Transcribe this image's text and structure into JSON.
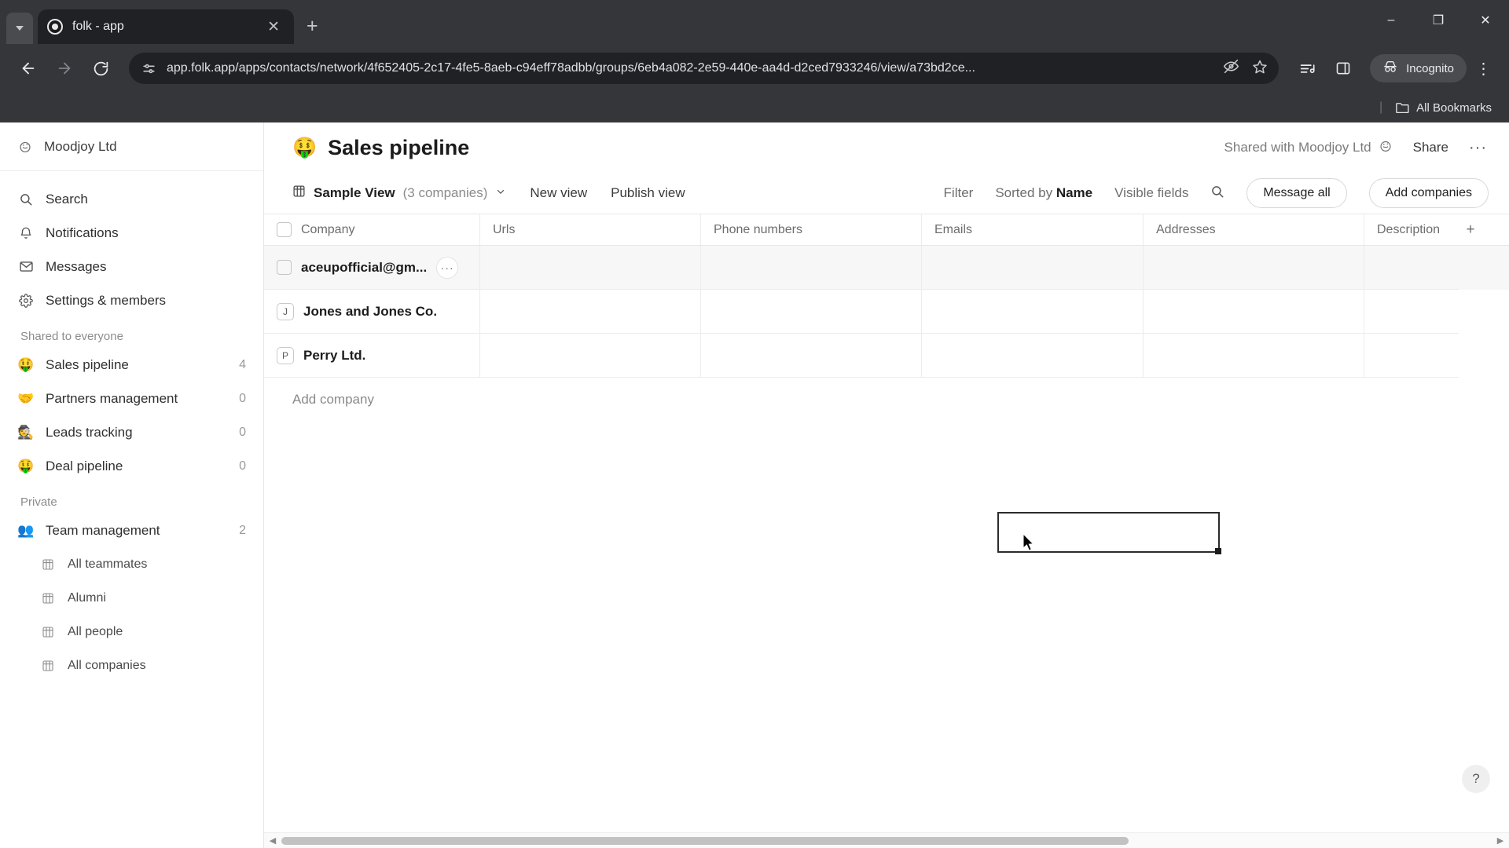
{
  "browser": {
    "tab": {
      "title": "folk - app",
      "favicon_icon": "folk-logo-icon",
      "close_icon": "close-icon"
    },
    "tab_list_icon": "chevron-down-icon",
    "new_tab_label": "+",
    "window_controls": {
      "minimize": "–",
      "maximize": "❐",
      "close": "✕"
    },
    "nav": {
      "back_icon": "arrow-left-icon",
      "forward_icon": "arrow-right-icon",
      "reload_icon": "reload-icon"
    },
    "omnibox": {
      "site_info_icon": "page-settings-icon",
      "url": "app.folk.app/apps/contacts/network/4f652405-2c17-4fe5-8aeb-c94eff78adbb/groups/6eb4a082-2e59-440e-aa4d-d2ced7933246/view/a73bd2ce...",
      "tracking_protection_icon": "eye-crossed-icon",
      "bookmark_icon": "star-icon"
    },
    "toolbar_right": {
      "reading_list_icon": "reading-list-icon",
      "side_panel_icon": "side-panel-icon",
      "incognito_label": "Incognito",
      "incognito_icon": "incognito-icon",
      "menu_icon": "kebab-menu-icon"
    },
    "bookmarks_bar": {
      "separator": "|",
      "all_bookmarks_label": "All Bookmarks",
      "folder_icon": "folder-icon"
    }
  },
  "sidebar": {
    "workspace": {
      "name": "Moodjoy Ltd",
      "logo_icon": "moodjoy-logo-icon"
    },
    "nav_items": [
      {
        "label": "Search",
        "icon": "search-icon"
      },
      {
        "label": "Notifications",
        "icon": "bell-icon"
      },
      {
        "label": "Messages",
        "icon": "envelope-icon"
      },
      {
        "label": "Settings & members",
        "icon": "gear-icon"
      }
    ],
    "shared_group": {
      "title": "Shared to everyone",
      "items": [
        {
          "label": "Sales pipeline",
          "emoji": "🤑",
          "count": "4"
        },
        {
          "label": "Partners management",
          "emoji": "🤝",
          "count": "0"
        },
        {
          "label": "Leads tracking",
          "emoji": "🕵️",
          "count": "0"
        },
        {
          "label": "Deal pipeline",
          "emoji": "🤑",
          "count": "0"
        }
      ]
    },
    "private_group": {
      "title": "Private",
      "items": [
        {
          "label": "Team management",
          "emoji": "👥",
          "count": "2"
        }
      ],
      "sub_items": [
        {
          "label": "All teammates",
          "icon": "table-icon"
        },
        {
          "label": "Alumni",
          "icon": "table-icon"
        },
        {
          "label": "All people",
          "icon": "table-icon"
        },
        {
          "label": "All companies",
          "icon": "table-icon"
        }
      ]
    }
  },
  "main": {
    "header": {
      "emoji": "🤑",
      "title": "Sales pipeline",
      "shared_with": "Shared with Moodjoy Ltd",
      "shared_avatar_icon": "moodjoy-logo-icon",
      "share_label": "Share",
      "more_label": "···"
    },
    "view_bar": {
      "view_icon": "table-icon",
      "view_name": "Sample View",
      "view_count": "(3 companies)",
      "view_chevron_icon": "chevron-down-icon",
      "new_view_label": "New view",
      "publish_view_label": "Publish view",
      "filter_label": "Filter",
      "sorted_prefix": "Sorted by ",
      "sorted_field": "Name",
      "visible_fields_label": "Visible fields",
      "search_icon": "search-icon",
      "message_all_label": "Message all",
      "add_companies_label": "Add companies"
    },
    "table": {
      "columns": [
        "Company",
        "Urls",
        "Phone numbers",
        "Emails",
        "Addresses",
        "Description"
      ],
      "add_column_icon": "plus-icon",
      "rows": [
        {
          "company": "aceupofficial@gm...",
          "avatar": "",
          "urls": "",
          "phone": "",
          "emails": "",
          "addresses": "",
          "description": "",
          "row_menu": "···"
        },
        {
          "company": "Jones and Jones Co.",
          "avatar": "J",
          "urls": "",
          "phone": "",
          "emails": "",
          "addresses": "",
          "description": ""
        },
        {
          "company": "Perry Ltd.",
          "avatar": "P",
          "urls": "",
          "phone": "",
          "emails": "",
          "addresses": "",
          "description": ""
        }
      ],
      "add_row_label": "Add company"
    },
    "help_label": "?",
    "scrollbar": {
      "left_arrow": "◀",
      "right_arrow": "▶"
    }
  },
  "colors": {
    "chrome_bg": "#35363a",
    "omnibox_bg": "#202124",
    "app_bg": "#ffffff",
    "border": "#ececec",
    "selection": "#2b2b2b",
    "muted_text": "#8b8b8b"
  }
}
